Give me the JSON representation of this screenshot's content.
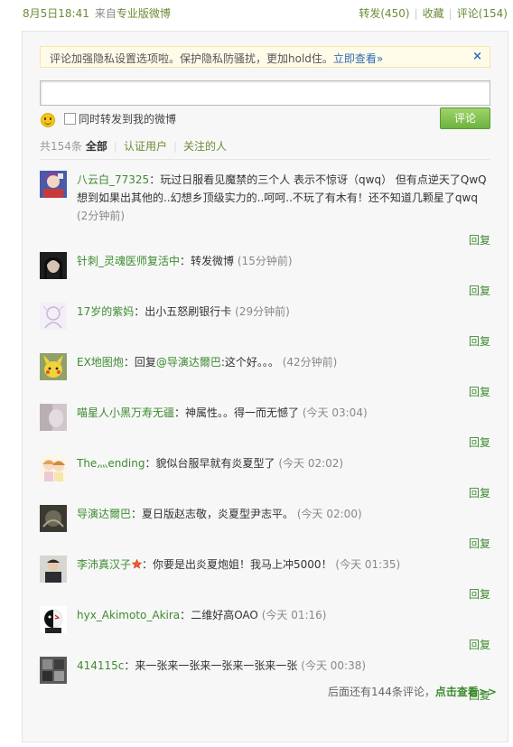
{
  "topbar": {
    "time": "8月5日18:41",
    "from_prefix": "来自",
    "source": "专业版微博",
    "repost": "转发(450)",
    "favorite": "收藏",
    "comment": "评论(154)",
    "sep": "|"
  },
  "notice": {
    "text": "评论加强隐私设置选项啦。保护隐私防骚扰，更加hold住。",
    "link": "立即查看»",
    "close": "×"
  },
  "composer": {
    "input_value": "",
    "repost_label": "同时转发到我的微博",
    "submit_label": "评论"
  },
  "filters": {
    "count": "共154条",
    "all": "全部",
    "verified": "认证用户",
    "following": "关注的人",
    "sep": "|"
  },
  "comments": [
    {
      "name": "八云白_77325",
      "colon": "：",
      "text": "玩过日服看见魔禁的三个人 表示不惊讶（qwq） 但有点逆天了QwQ 想到如果出其他的..幻想乡顶级实力的..呵呵..不玩了有木有！还不知道几颗星了qwq",
      "time": "(2分钟前)",
      "reply": "回复"
    },
    {
      "name": "针刺_灵魂医师复活中",
      "colon": "：",
      "text": "转发微博",
      "time": "(15分钟前)",
      "reply": "回复"
    },
    {
      "name": "17岁的紫妈",
      "colon": "：",
      "text": "出小五怒刷银行卡",
      "time": "(29分钟前)",
      "reply": "回复"
    },
    {
      "name": "EX地图炮",
      "colon": "：",
      "pre": "回复",
      "mention": "@导演达爾巴",
      "text": ":这个好。。。",
      "time": "(42分钟前)",
      "reply": "回复"
    },
    {
      "name": "喵星人小黑万寿无疆",
      "colon": "：",
      "text": "神属性。。得一而无憾了",
      "time": "(今天 03:04)",
      "reply": "回复"
    },
    {
      "name": "The灬ending",
      "colon": "：",
      "text": "貌似台服早就有炎夏型了",
      "time": "(今天 02:02)",
      "reply": "回复"
    },
    {
      "name": "导演达爾巴",
      "colon": "：",
      "text": "夏日版赵志敬，炎夏型尹志平。",
      "time": "(今天 02:00)",
      "reply": "回复"
    },
    {
      "name": "李沛真汉子",
      "colon": "：",
      "text": "你要是出炎夏炮姐！我马上冲5000！",
      "time": "(今天 01:35)",
      "reply": "回复"
    },
    {
      "name": "hyx_Akimoto_Akira",
      "colon": "：",
      "text": "二维好高OAO",
      "time": "(今天 01:16)",
      "reply": "回复"
    },
    {
      "name": "414115c",
      "colon": "：",
      "text": "来一张来一张来一张来一张来一张",
      "time": "(今天 00:38)",
      "reply": "回复"
    }
  ],
  "footer": {
    "remaining": "后面还有144条评论，",
    "more": "点击查看>>"
  }
}
